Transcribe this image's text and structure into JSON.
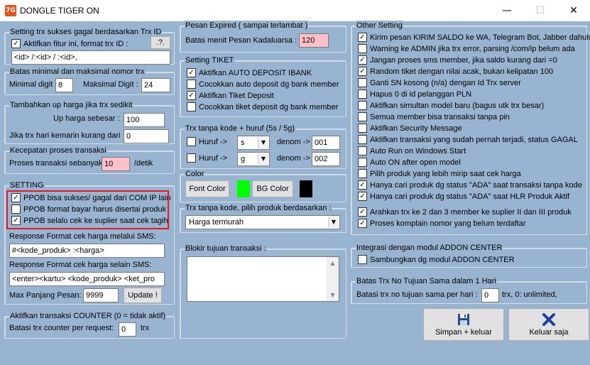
{
  "window": {
    "title": "DONGLE TIGER ON",
    "icon_text": "7G",
    "minimize": "—",
    "maximize": "☐",
    "close": "✕"
  },
  "setting_trx_gagal": {
    "title": "Setting trx sukses gagal berdasarkan Trx ID",
    "checkbox_label": "Aktifkan fitur ini, format trx ID :",
    "checked": true,
    "help_button": ".?.",
    "format_value": "<id> /:<id> / :<id>,"
  },
  "batas_nomor": {
    "title": "Batas minimal dan maksimal nomor trx",
    "min_label": "Minimal digit :",
    "min_value": "8",
    "max_label": "Maksimal Digit :",
    "max_value": "24"
  },
  "tambah_harga": {
    "title": "Tambahkan up harga jika trx sedikit",
    "up_label": "Up harga sebesar :",
    "up_value": "100",
    "kurang_label": "Jika trx hari kemarin kurang dari",
    "kurang_value": "0"
  },
  "kecepatan": {
    "title": "Kecepatan proses transaksi",
    "label": "Proses transaksi sebanyak",
    "value": "10",
    "unit": "/detik"
  },
  "setting": {
    "title": "SETTING",
    "items": [
      {
        "label": "PPOB bisa sukses/ gagal dari COM IP lain",
        "checked": true
      },
      {
        "label": "PPOB format bayar harus disertai produk",
        "checked": false
      },
      {
        "label": "PPOB selalu cek ke suplier saat cek tagihan",
        "checked": true
      }
    ],
    "response_sms_label": "Response Format cek harga melalui SMS:",
    "response_sms_value": "#<kode_produk> :<harga>",
    "response_other_label": "Response Format cek harga selain SMS:",
    "response_other_value": "<enter><kartu> <kode_produk> <ket_pro",
    "max_pesan_label": "Max Panjang Pesan:",
    "max_pesan_value": "9999",
    "update_button": "Update !"
  },
  "counter": {
    "title": "Aktifkan transaksi COUNTER (0 = tidak aktif)",
    "label": "Batasi trx counter per request:",
    "value": "0",
    "unit": "trx"
  },
  "pesan_expired": {
    "title": "Pesan Expired ( sampai terlambat )",
    "label": "Batas menit Pesan Kadaluarsa :",
    "value": "120"
  },
  "setting_tiket": {
    "title": "Setting TIKET",
    "items": [
      {
        "label": "Aktifkan AUTO DEPOSIT IBANK",
        "checked": true
      },
      {
        "label": "Cocokkan auto deposit dg bank member",
        "checked": false
      },
      {
        "label": "Aktifkan Tiket Deposit",
        "checked": true
      },
      {
        "label": "Cocokkan tiket deposit dg bank member",
        "checked": false
      }
    ]
  },
  "trx_tanpa_kode_huruf": {
    "title": "Trx tanpa kode + huruf (5s / 5g)",
    "rows": [
      {
        "label": "Huruf ->",
        "checked": false,
        "letter": "s",
        "denom_label": "denom ->",
        "denom_value": "001"
      },
      {
        "label": "Huruf ->",
        "checked": false,
        "letter": "g",
        "denom_label": "denom ->",
        "denom_value": "002"
      }
    ]
  },
  "color": {
    "title": "Color",
    "font_button": "Font Color",
    "font_color": "#00ff00",
    "bg_button": "BG Color",
    "bg_color": "#000000"
  },
  "trx_pilih_produk": {
    "title": "Trx tanpa kode, pilih produk berdasarkan :",
    "selected": "Harga termurah"
  },
  "blokir": {
    "title": "Blokir tujuan transaksi :"
  },
  "other_setting": {
    "title": "Other Setting",
    "items": [
      {
        "label": "Kirim pesan KIRIM SALDO ke WA, Telegram Bot, Jabber dahulu",
        "checked": true
      },
      {
        "label": "Warning ke ADMIN jika trx error, parsing /com/ip belum ada",
        "checked": false
      },
      {
        "label": "Jangan proses sms member, jika saldo kurang dari   =0",
        "checked": true
      },
      {
        "label": "Random tiket dengan nilai acak, bukan kelipatan 100",
        "checked": true
      },
      {
        "label": "Ganti SN kosong (n/a) dengan Id Trx server",
        "checked": false
      },
      {
        "label": "Hapus 0 di id pelanggan PLN",
        "checked": false
      },
      {
        "label": "Aktifkan simultan model baru (bagus utk trx besar)",
        "checked": false
      },
      {
        "label": "Semua member bisa transaksi tanpa pin",
        "checked": false
      },
      {
        "label": "Aktifkan Security Message",
        "checked": false
      },
      {
        "label": "Aktifkan transaksi yang sudah pernah terjadi, status GAGAL",
        "checked": false
      },
      {
        "label": "Auto Run on Windows Start",
        "checked": false
      },
      {
        "label": "Auto ON after open model",
        "checked": false
      },
      {
        "label": "Pilih produk yang lebih mirip saat cek harga",
        "checked": false
      },
      {
        "label": "Hanya cari produk dg status \"ADA\" saat transaksi tanpa kode",
        "checked": true
      },
      {
        "label": "Hanya cari produk dg status \"ADA\" saat HLR Produk Aktif",
        "checked": true
      },
      {
        "label": "Arahkan trx ke 2  dan 3 member ke suplier II dan III produk",
        "checked": true
      },
      {
        "label": "Proses komplain nomor yang belum terdaftar",
        "checked": true
      }
    ]
  },
  "addon": {
    "title": "Integrasi dengan modul ADDON CENTER",
    "label": "Sambungkan dg modul ADDON CENTER",
    "checked": false
  },
  "batas_trx": {
    "title": "Batas Trx No Tujuan Sama dalam 1 Hari",
    "label": "Batasi trx no tujuan sama per hari :",
    "value": "0",
    "unit": "trx, 0: unlimited,"
  },
  "actions": {
    "save_label": "Simpan + keluar",
    "exit_label": "Keluar saja"
  }
}
